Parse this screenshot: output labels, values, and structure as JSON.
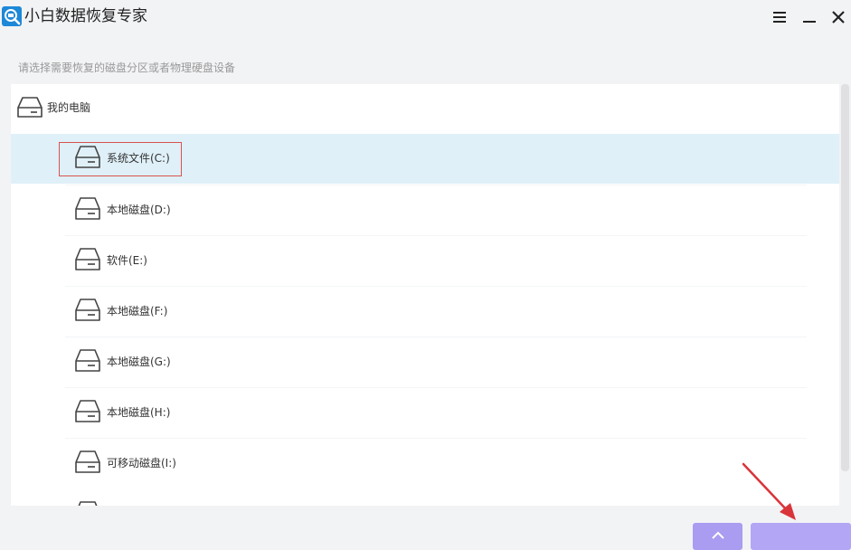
{
  "app": {
    "title": "小白数据恢复专家"
  },
  "window_controls": [
    "menu-icon",
    "minimize-icon",
    "close-icon"
  ],
  "hint": "请选择需要恢复的磁盘分区或者物理硬盘设备",
  "tree": {
    "root_label": "我的电脑",
    "drives": [
      {
        "label": "系统文件(C:)",
        "selected": true
      },
      {
        "label": "本地磁盘(D:)",
        "selected": false
      },
      {
        "label": "软件(E:)",
        "selected": false
      },
      {
        "label": "本地磁盘(F:)",
        "selected": false
      },
      {
        "label": "本地磁盘(G:)",
        "selected": false
      },
      {
        "label": "本地磁盘(H:)",
        "selected": false
      },
      {
        "label": "可移动磁盘(I:)",
        "selected": false
      }
    ]
  },
  "colors": {
    "selected_row": "#dff0f8",
    "selection_outline": "#d9534f",
    "button_purple": "#a99cf1",
    "annotation_arrow": "#d9343a",
    "logo_blue": "#1e88d8"
  }
}
